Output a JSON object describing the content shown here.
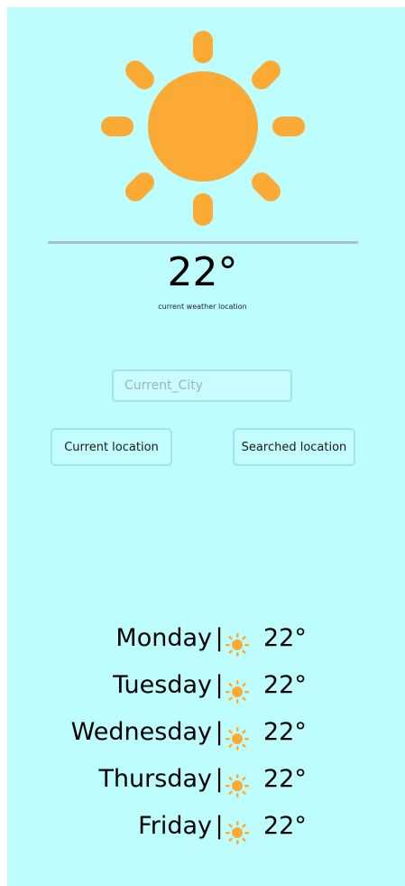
{
  "colors": {
    "background": "#bdfdfd",
    "sun": "#fbaa35",
    "divider": "#a9c2c4",
    "border": "#9fe5ea"
  },
  "current": {
    "icon": "sun-icon",
    "temperature": "22°",
    "location_label": "current weather location"
  },
  "search": {
    "placeholder": "Current_City"
  },
  "buttons": {
    "current_location": "Current location",
    "searched_location": "Searched location"
  },
  "forecast": [
    {
      "day": "Monday",
      "separator": "|",
      "icon": "sun-icon",
      "temp": "22°"
    },
    {
      "day": "Tuesday",
      "separator": "|",
      "icon": "sun-icon",
      "temp": "22°"
    },
    {
      "day": "Wednesday",
      "separator": "|",
      "icon": "sun-icon",
      "temp": "22°"
    },
    {
      "day": "Thursday",
      "separator": "|",
      "icon": "sun-icon",
      "temp": "22°"
    },
    {
      "day": "Friday",
      "separator": "|",
      "icon": "sun-icon",
      "temp": "22°"
    }
  ]
}
